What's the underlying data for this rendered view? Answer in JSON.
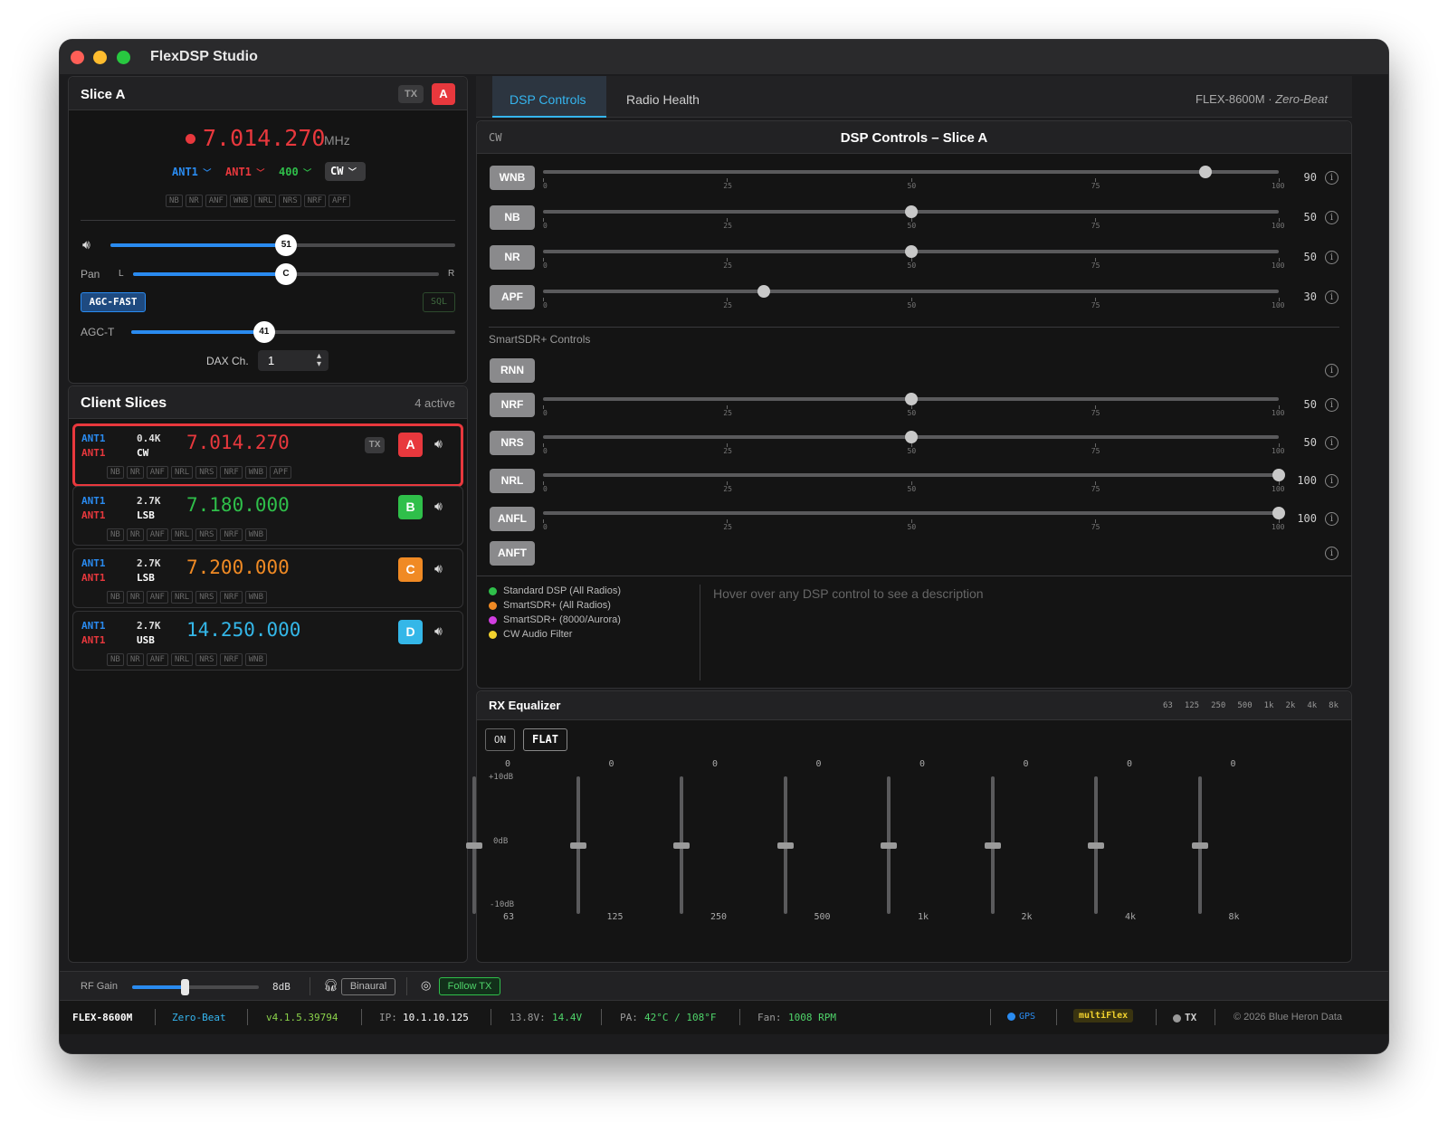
{
  "app": {
    "title": "FlexDSP Studio"
  },
  "slice_panel": {
    "title": "Slice A",
    "tx_label": "TX",
    "letter": "A",
    "frequency": "7.014.270",
    "unit": "MHz",
    "ant_rx": "ANT1",
    "ant_tx": "ANT1",
    "filter": "400",
    "mode": "CW",
    "dsp_chips": [
      "NB",
      "NR",
      "ANF",
      "WNB",
      "NRL",
      "NRS",
      "NRF",
      "APF"
    ],
    "volume_value": "51",
    "volume_level": 0.51,
    "pan_label": "Pan",
    "pan_left": "L",
    "pan_right": "R",
    "pan_value": "C",
    "pan_level": 0.5,
    "agc_mode": "AGC-FAST",
    "sql_label": "SQL",
    "agct_label": "AGC-T",
    "agct_value": "41",
    "agct_level": 0.41,
    "dax_label": "DAX Ch.",
    "dax_value": "1"
  },
  "client_slices": {
    "title": "Client Slices",
    "count": "4 active",
    "tx_label": "TX",
    "rows": [
      {
        "ant_rx": "ANT1",
        "ant_tx": "ANT1",
        "bw": "0.4K",
        "mode": "CW",
        "freq": "7.014.270",
        "letter": "A",
        "chips": [
          "NB",
          "NR",
          "ANF",
          "NRL",
          "NRS",
          "NRF",
          "WNB",
          "APF"
        ]
      },
      {
        "ant_rx": "ANT1",
        "ant_tx": "ANT1",
        "bw": "2.7K",
        "mode": "LSB",
        "freq": "7.180.000",
        "letter": "B",
        "chips": [
          "NB",
          "NR",
          "ANF",
          "NRL",
          "NRS",
          "NRF",
          "WNB"
        ]
      },
      {
        "ant_rx": "ANT1",
        "ant_tx": "ANT1",
        "bw": "2.7K",
        "mode": "LSB",
        "freq": "7.200.000",
        "letter": "C",
        "chips": [
          "NB",
          "NR",
          "ANF",
          "NRL",
          "NRS",
          "NRF",
          "WNB"
        ]
      },
      {
        "ant_rx": "ANT1",
        "ant_tx": "ANT1",
        "bw": "2.7K",
        "mode": "USB",
        "freq": "14.250.000",
        "letter": "D",
        "chips": [
          "NB",
          "NR",
          "ANF",
          "NRL",
          "NRS",
          "NRF",
          "WNB"
        ]
      }
    ]
  },
  "tabs": {
    "dsp": "DSP Controls",
    "health": "Radio Health",
    "radio_model": "FLEX-8600M",
    "separator": "·",
    "radio_nick": "Zero-Beat"
  },
  "dsp": {
    "mode_tag": "CW",
    "title": "DSP Controls – Slice A",
    "tick_labels": [
      "0",
      "25",
      "50",
      "75",
      "100"
    ],
    "standard": [
      {
        "label": "WNB",
        "value": "90",
        "level": 90
      },
      {
        "label": "NB",
        "value": "50",
        "level": 50
      },
      {
        "label": "NR",
        "value": "50",
        "level": 50
      },
      {
        "label": "APF",
        "value": "30",
        "level": 30
      }
    ],
    "smartsdr_title": "SmartSDR+ Controls",
    "smartsdr": [
      {
        "label": "RNN",
        "value": "",
        "level": null
      },
      {
        "label": "NRF",
        "value": "50",
        "level": 50
      },
      {
        "label": "NRS",
        "value": "50",
        "level": 50
      },
      {
        "label": "NRL",
        "value": "100",
        "level": 100
      },
      {
        "label": "ANFL",
        "value": "100",
        "level": 100
      },
      {
        "label": "ANFT",
        "value": "",
        "level": null
      }
    ],
    "legend": [
      {
        "label": "Standard DSP (All Radios)",
        "color": "#2fbf4a"
      },
      {
        "label": "SmartSDR+ (All Radios)",
        "color": "#f08a24"
      },
      {
        "label": "SmartSDR+ (8000/Aurora)",
        "color": "#d23ee0"
      },
      {
        "label": "CW Audio Filter",
        "color": "#f2d22e"
      }
    ],
    "hint": "Hover over any DSP control to see a description"
  },
  "eq": {
    "title": "RX Equalizer",
    "header_bands": [
      "63",
      "125",
      "250",
      "500",
      "1k",
      "2k",
      "4k",
      "8k"
    ],
    "on_label": "ON",
    "flat_label": "FLAT",
    "scale_top": "+10dB",
    "scale_mid": "0dB",
    "scale_bottom": "-10dB",
    "bands": [
      {
        "label": "63",
        "value": "0"
      },
      {
        "label": "125",
        "value": "0"
      },
      {
        "label": "250",
        "value": "0"
      },
      {
        "label": "500",
        "value": "0"
      },
      {
        "label": "1k",
        "value": "0"
      },
      {
        "label": "2k",
        "value": "0"
      },
      {
        "label": "4k",
        "value": "0"
      },
      {
        "label": "8k",
        "value": "0"
      }
    ]
  },
  "bottom_bar": {
    "rf_gain_label": "RF Gain",
    "rf_gain_value": "8dB",
    "rf_gain_level": 0.42,
    "binaural_label": "Binaural",
    "follow_tx_label": "Follow TX"
  },
  "status_bar": {
    "model": "FLEX-8600M",
    "nick": "Zero-Beat",
    "version": "v4.1.5.39794",
    "ip_label": "IP:",
    "ip": "10.1.10.125",
    "volt_label": "13.8V:",
    "volt": "14.4V",
    "pa_label": "PA:",
    "pa": "42°C / 108°F",
    "fan_label": "Fan:",
    "fan": "1008 RPM",
    "gps_label": "GPS",
    "multiflex_label": "multiFlex",
    "tx_label": "TX",
    "copyright": "© 2026 Blue Heron Data"
  },
  "colors": {
    "accent_blue": "#2a8bf0",
    "tab_active": "#35b5ef",
    "freq_red": "#e8383d",
    "freq_green": "#2fbf4a",
    "freq_orange": "#f08a24",
    "freq_cyan": "#34b7e8"
  }
}
